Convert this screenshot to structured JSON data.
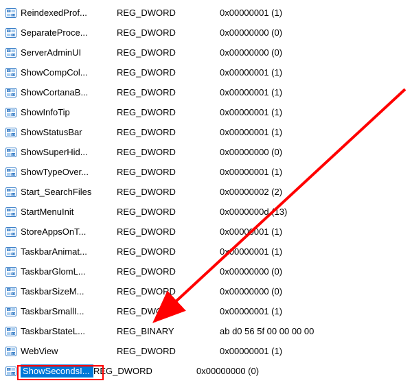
{
  "rows": [
    {
      "name": "ReindexedProf...",
      "type": "REG_DWORD",
      "data": "0x00000001 (1)",
      "selected": false
    },
    {
      "name": "SeparateProce...",
      "type": "REG_DWORD",
      "data": "0x00000000 (0)",
      "selected": false
    },
    {
      "name": "ServerAdminUI",
      "type": "REG_DWORD",
      "data": "0x00000000 (0)",
      "selected": false
    },
    {
      "name": "ShowCompCol...",
      "type": "REG_DWORD",
      "data": "0x00000001 (1)",
      "selected": false
    },
    {
      "name": "ShowCortanaB...",
      "type": "REG_DWORD",
      "data": "0x00000001 (1)",
      "selected": false
    },
    {
      "name": "ShowInfoTip",
      "type": "REG_DWORD",
      "data": "0x00000001 (1)",
      "selected": false
    },
    {
      "name": "ShowStatusBar",
      "type": "REG_DWORD",
      "data": "0x00000001 (1)",
      "selected": false
    },
    {
      "name": "ShowSuperHid...",
      "type": "REG_DWORD",
      "data": "0x00000000 (0)",
      "selected": false
    },
    {
      "name": "ShowTypeOver...",
      "type": "REG_DWORD",
      "data": "0x00000001 (1)",
      "selected": false
    },
    {
      "name": "Start_SearchFiles",
      "type": "REG_DWORD",
      "data": "0x00000002 (2)",
      "selected": false
    },
    {
      "name": "StartMenuInit",
      "type": "REG_DWORD",
      "data": "0x0000000d (13)",
      "selected": false
    },
    {
      "name": "StoreAppsOnT...",
      "type": "REG_DWORD",
      "data": "0x00000001 (1)",
      "selected": false
    },
    {
      "name": "TaskbarAnimat...",
      "type": "REG_DWORD",
      "data": "0x00000001 (1)",
      "selected": false
    },
    {
      "name": "TaskbarGlomL...",
      "type": "REG_DWORD",
      "data": "0x00000000 (0)",
      "selected": false
    },
    {
      "name": "TaskbarSizeM...",
      "type": "REG_DWORD",
      "data": "0x00000000 (0)",
      "selected": false
    },
    {
      "name": "TaskbarSmallI...",
      "type": "REG_DWORD",
      "data": "0x00000001 (1)",
      "selected": false
    },
    {
      "name": "TaskbarStateL...",
      "type": "REG_BINARY",
      "data": "ab d0 56 5f 00 00 00 00",
      "selected": false
    },
    {
      "name": "WebView",
      "type": "REG_DWORD",
      "data": "0x00000001 (1)",
      "selected": false
    },
    {
      "name": "ShowSecondsI...",
      "type": "REG_DWORD",
      "data": "0x00000000 (0)",
      "selected": true
    }
  ]
}
